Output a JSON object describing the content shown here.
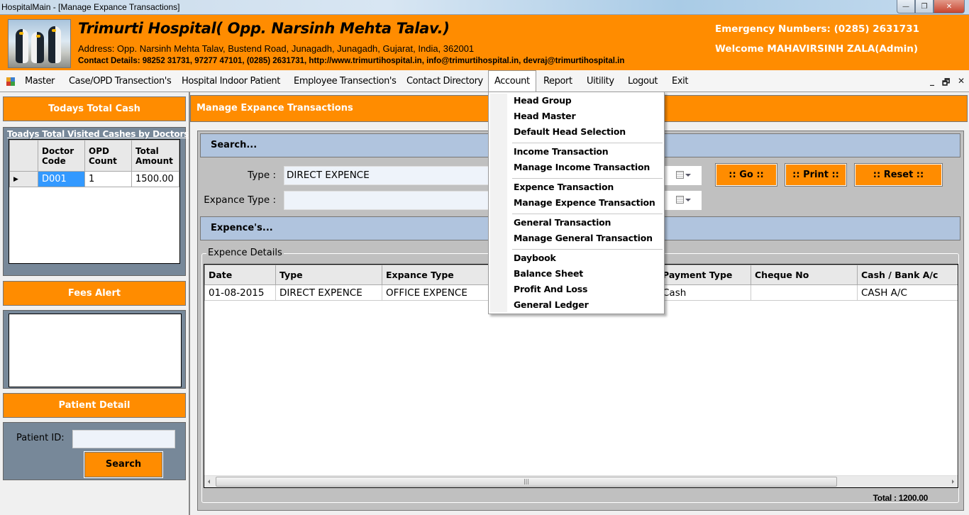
{
  "window": {
    "title": "HospitalMain - [Manage Expance Transactions]",
    "controls": {
      "minimize": "—",
      "restore": "❐",
      "close": "✕"
    }
  },
  "header": {
    "hospital_name": "Trimurti Hospital( Opp. Narsinh Mehta Talav.)",
    "address": "Address: Opp. Narsinh Mehta Talav, Bustend Road, Junagadh, Junagadh, Gujarat, India, 362001",
    "contact": "Contact Details: 98252 31731, 97277 47101, (0285) 2631731, http://www.trimurtihospital.in, info@trimurtihospital.in, devraj@trimurtihospital.in",
    "emergency": "Emergency Numbers: (0285) 2631731",
    "welcome": "Welcome MAHAVIRSINH ZALA(Admin)",
    "logo_icon": "penguins-image"
  },
  "menubar": {
    "items": [
      {
        "label": "Master"
      },
      {
        "label": "Case/OPD Transection's"
      },
      {
        "label": "Hospital Indoor Patient"
      },
      {
        "label": "Employee Transection's"
      },
      {
        "label": "Contact Directory"
      },
      {
        "label": "Account",
        "open": true
      },
      {
        "label": "Report"
      },
      {
        "label": "Uitility"
      },
      {
        "label": "Logout"
      },
      {
        "label": "Exit"
      }
    ],
    "mdi_controls": {
      "minimize": "_",
      "restore": "🗗",
      "close": "✕"
    }
  },
  "account_menu": {
    "groups": [
      [
        "Head Group",
        "Head Master",
        "Default Head Selection"
      ],
      [
        "Income Transaction",
        "Manage Income Transaction"
      ],
      [
        "Expence Transaction",
        "Manage Expence Transaction"
      ],
      [
        "General Transaction",
        "Manage General Transaction"
      ],
      [
        "Daybook",
        "Balance Sheet",
        "Profit And Loss",
        "General Ledger"
      ]
    ]
  },
  "sidebar": {
    "todays_cash_title": "Todays Total Cash",
    "grid_title": "Toadys Total Visited Cashes by Doctors",
    "grid_columns": [
      "Doctor Code",
      "OPD Count",
      "Total Amount"
    ],
    "grid_rows": [
      {
        "doctor_code": "D001",
        "opd_count": "1",
        "total_amount": "1500.00"
      }
    ],
    "fees_alert_title": "Fees Alert",
    "patient_detail_title": "Patient Detail",
    "patient_id_label": "Patient ID:",
    "patient_id_value": "",
    "search_label": "Search"
  },
  "main": {
    "title": "Manage Expance Transactions",
    "search_section": "Search...",
    "type_label": "Type :",
    "type_value": "DIRECT EXPENCE",
    "expance_type_label": "Expance Type :",
    "expance_type_value": "",
    "buttons": {
      "go": ":: Go ::",
      "print": ":: Print ::",
      "reset": ":: Reset ::"
    },
    "expences_section": "Expence's...",
    "details_legend": "Expence Details",
    "columns": [
      "Date",
      "Type",
      "Expance Type",
      "",
      "Payment Type",
      "Cheque No",
      "Cash / Bank A/c"
    ],
    "rows": [
      {
        "date": "01-08-2015",
        "type": "DIRECT EXPENCE",
        "expance_type": "OFFICE EXPENCE",
        "hidden": "",
        "payment_type": "Cash",
        "cheque_no": "",
        "cash_bank": "CASH A/C"
      }
    ],
    "scroll_grip": "|||",
    "total": "Total : 1200.00"
  }
}
